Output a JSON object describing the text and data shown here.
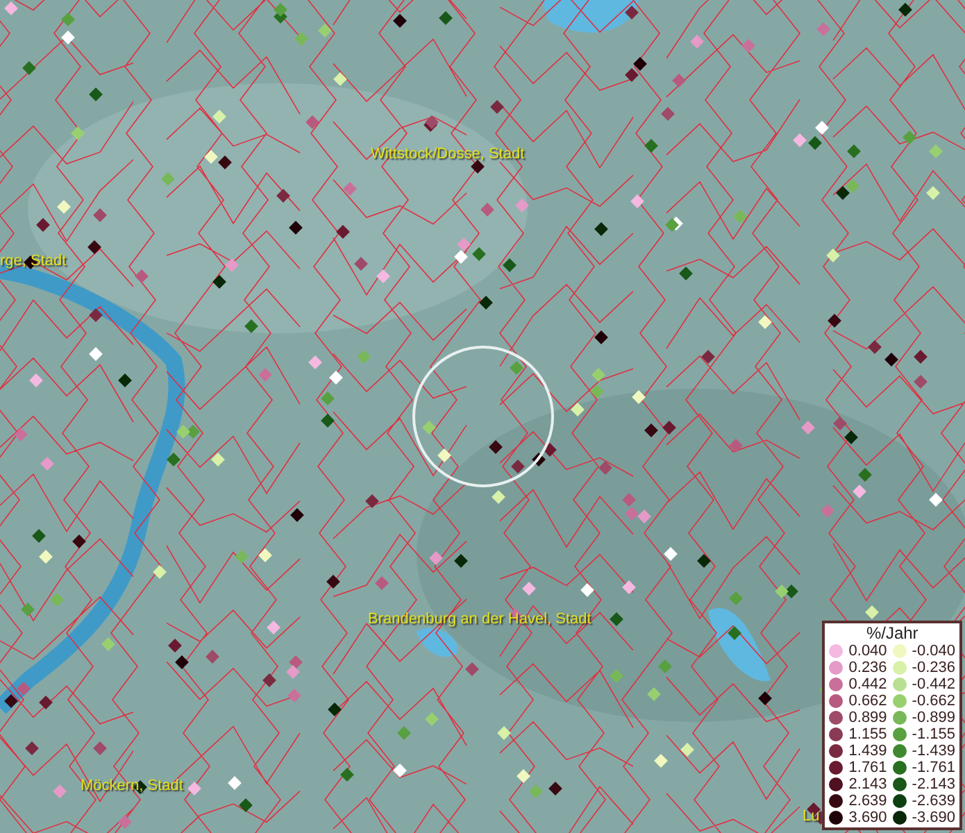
{
  "map_labels": [
    {
      "text": "Wittstock/Dosse, Stadt"
    },
    {
      "text": "rge, Stadt"
    },
    {
      "text": "Brandenburg an der Havel, Stadt"
    },
    {
      "text": "Möckern, Stadt"
    },
    {
      "text": "Lu"
    }
  ],
  "legend": {
    "title": "%/Jahr",
    "positive": [
      {
        "label": "0.040",
        "color": "#f5b8e0"
      },
      {
        "label": "0.236",
        "color": "#e59ac8"
      },
      {
        "label": "0.442",
        "color": "#c8709a"
      },
      {
        "label": "0.662",
        "color": "#b85a80"
      },
      {
        "label": "0.899",
        "color": "#9e4a68"
      },
      {
        "label": "1.155",
        "color": "#8a3a55"
      },
      {
        "label": "1.439",
        "color": "#7a2a40"
      },
      {
        "label": "1.761",
        "color": "#6a1a30"
      },
      {
        "label": "2.143",
        "color": "#501020"
      },
      {
        "label": "2.639",
        "color": "#380810"
      },
      {
        "label": "3.690",
        "color": "#200008"
      }
    ],
    "negative": [
      {
        "label": "-0.040",
        "color": "#f0f8c0"
      },
      {
        "label": "-0.236",
        "color": "#d8f0a8"
      },
      {
        "label": "-0.442",
        "color": "#b8e090"
      },
      {
        "label": "-0.662",
        "color": "#98d070"
      },
      {
        "label": "-0.899",
        "color": "#78b858"
      },
      {
        "label": "-1.155",
        "color": "#58a040"
      },
      {
        "label": "-1.439",
        "color": "#408830"
      },
      {
        "label": "-1.761",
        "color": "#287020"
      },
      {
        "label": "-2.143",
        "color": "#185818"
      },
      {
        "label": "-2.639",
        "color": "#0c4010"
      },
      {
        "label": "-3.690",
        "color": "#082808"
      }
    ]
  }
}
